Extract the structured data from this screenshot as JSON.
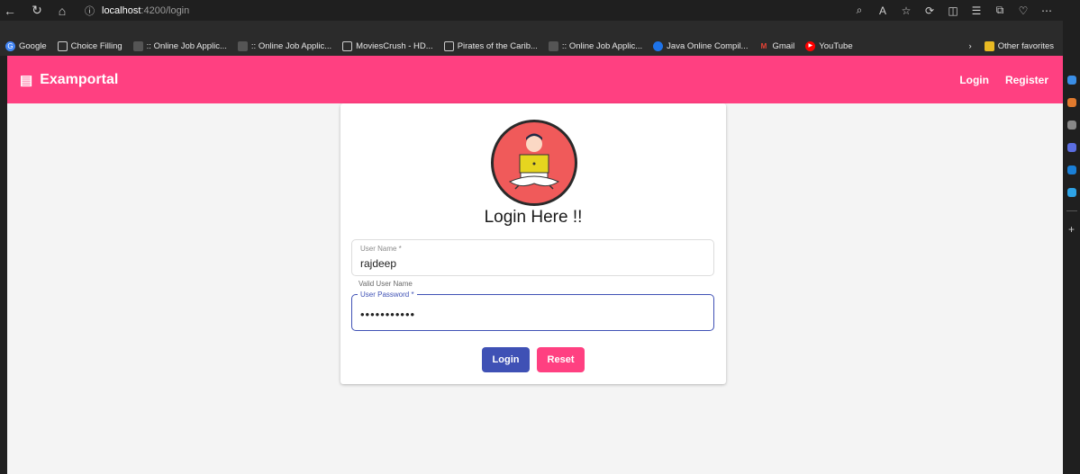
{
  "browser": {
    "url_host": "localhost",
    "url_path": ":4200/login",
    "bookmarks": [
      {
        "label": "Google",
        "icon": "google-icon",
        "color": "#4285f4"
      },
      {
        "label": "Choice Filling",
        "icon": "page-icon",
        "color": "#cccccc"
      },
      {
        "label": ":: Online Job Applic...",
        "icon": "avatar-icon",
        "color": "#555555"
      },
      {
        "label": ":: Online Job Applic...",
        "icon": "avatar-icon",
        "color": "#555555"
      },
      {
        "label": "MoviesCrush - HD...",
        "icon": "page-icon",
        "color": "#cccccc"
      },
      {
        "label": "Pirates of the Carib...",
        "icon": "page-icon",
        "color": "#cccccc"
      },
      {
        "label": ":: Online Job Applic...",
        "icon": "avatar-icon",
        "color": "#555555"
      },
      {
        "label": "Java Online Compil...",
        "icon": "compiler-icon",
        "color": "#1e73e8"
      },
      {
        "label": "Gmail",
        "icon": "gmail-icon",
        "color": "#ea4335"
      },
      {
        "label": "YouTube",
        "icon": "youtube-icon",
        "color": "#ff0000"
      }
    ],
    "other_favorites": "Other favorites"
  },
  "app": {
    "brand": "Examportal",
    "nav": {
      "login": "Login",
      "register": "Register"
    },
    "accent": "#ff4081",
    "primary": "#3f51b5"
  },
  "form": {
    "title": "Login Here !!",
    "username": {
      "label": "User Name *",
      "value": "rajdeep",
      "hint": "Valid User Name"
    },
    "password": {
      "label": "User Password *",
      "value": "•••••••••••"
    },
    "buttons": {
      "login": "Login",
      "reset": "Reset"
    }
  }
}
